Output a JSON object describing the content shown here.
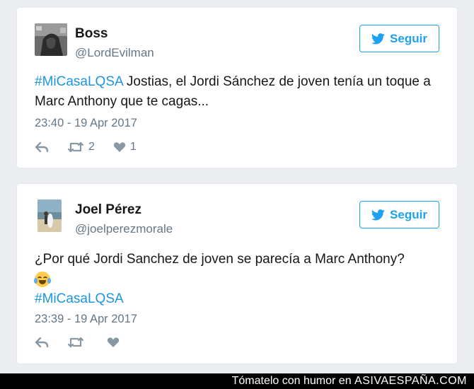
{
  "tweets": [
    {
      "name": "Boss",
      "handle": "@LordEvilman",
      "follow_label": "Seguir",
      "hashtag": "#MiCasaLQSA",
      "text": " Jostias, el Jordi Sánchez de joven tenía un toque a Marc Anthony que te cagas...",
      "timestamp": "23:40 - 19 Apr 2017",
      "retweets": "2",
      "likes": "1"
    },
    {
      "name": "Joel Pérez",
      "handle": "@joelperezmorale",
      "follow_label": "Seguir",
      "text": "¿Por qué Jordi Sanchez de joven se parecía a Marc Anthony?",
      "emoji": "face-with-tears-of-joy",
      "hashtag": "#MiCasaLQSA",
      "timestamp": "23:39 - 19 Apr 2017"
    }
  ],
  "footer": {
    "prefix": "Tómatelo con humor en ",
    "site": "ASIVAESPAÑA.COM"
  },
  "colors": {
    "twitter_blue": "#1da1f2",
    "hashtag": "#1b95e0",
    "muted": "#657786",
    "background": "#ebedf0"
  },
  "icons": [
    "twitter-bird-icon",
    "reply-icon",
    "retweet-icon",
    "heart-icon"
  ]
}
